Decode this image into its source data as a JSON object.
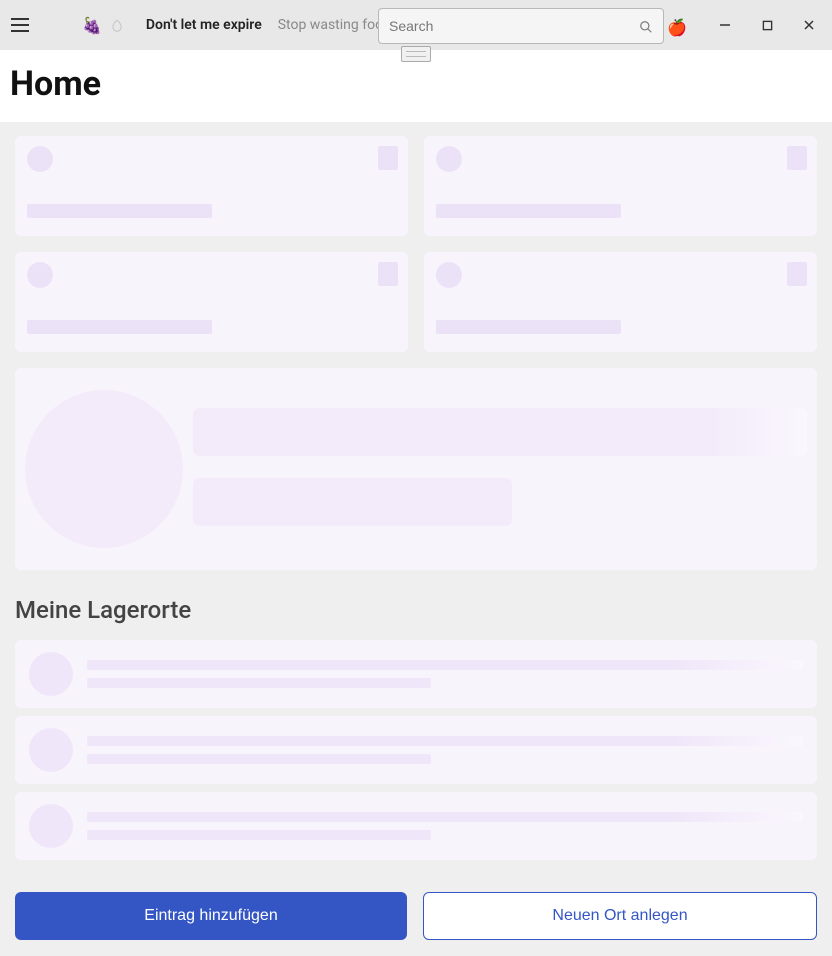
{
  "titlebar": {
    "app_title": "Don't let me expire",
    "app_subtitle": "Stop wasting food",
    "search_placeholder": "Search",
    "logo_emoji": "🍇",
    "overflow_emoji": "🍎"
  },
  "page": {
    "title": "Home",
    "section_title": "Meine Lagerorte"
  },
  "buttons": {
    "primary": "Eintrag hinzufügen",
    "secondary": "Neuen Ort anlegen"
  }
}
